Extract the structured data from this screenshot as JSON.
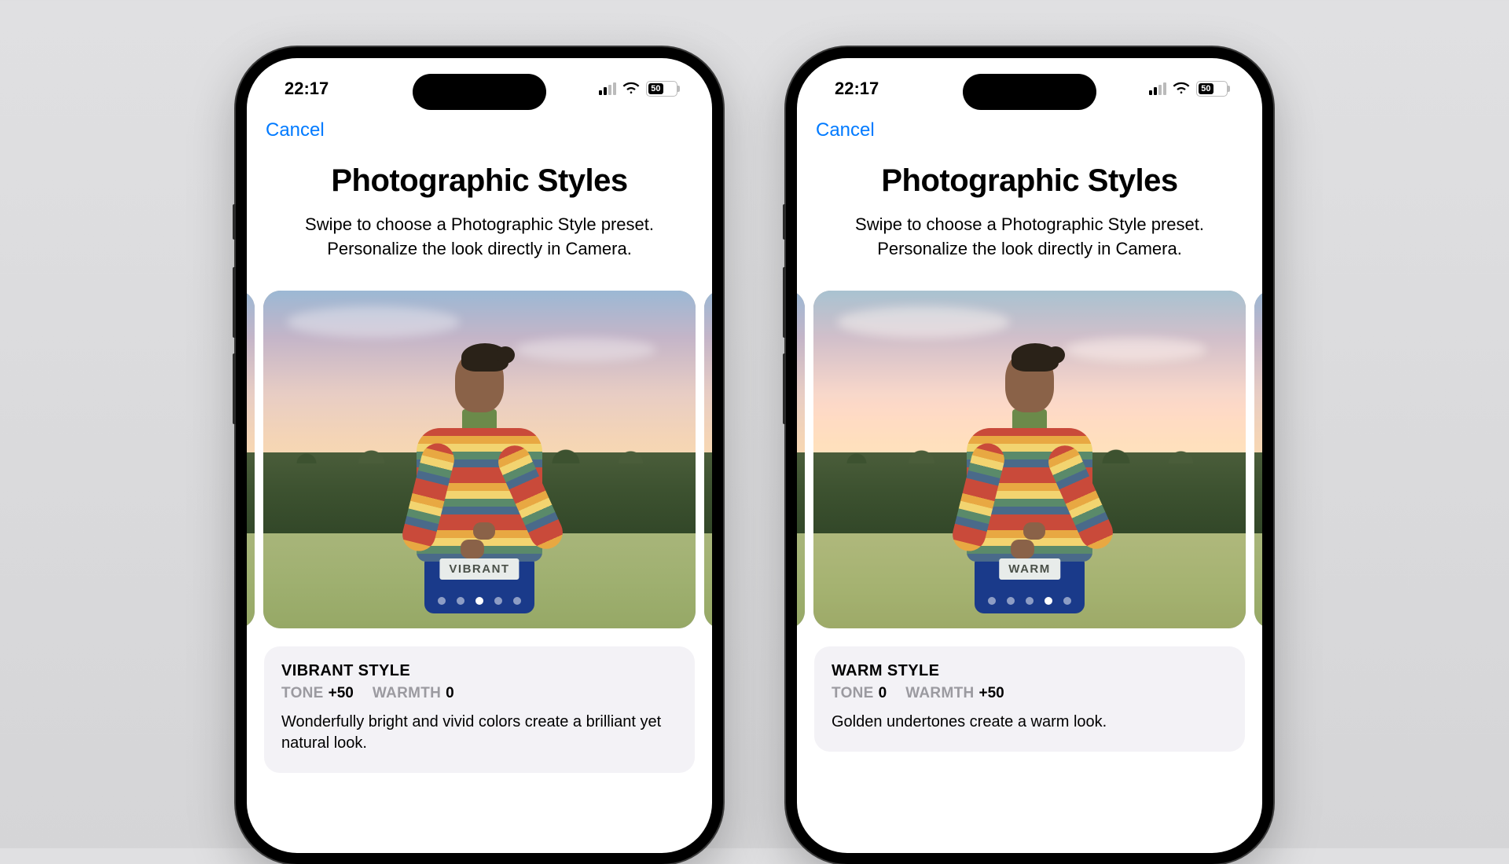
{
  "statusBar": {
    "time": "22:17",
    "batteryText": "50"
  },
  "nav": {
    "cancel": "Cancel"
  },
  "header": {
    "title": "Photographic Styles",
    "subtitle_line1": "Swipe to choose a Photographic Style preset.",
    "subtitle_line2": "Personalize the look directly in Camera."
  },
  "paramLabels": {
    "tone": "TONE",
    "warmth": "WARMTH"
  },
  "phones": [
    {
      "chipLabel": "VIBRANT",
      "activeDotIndex": 2,
      "styleName": "VIBRANT STYLE",
      "tone": "+50",
      "warmth": "0",
      "description": "Wonderfully bright and vivid colors create a brilliant yet natural look.",
      "tint": ""
    },
    {
      "chipLabel": "WARM",
      "activeDotIndex": 3,
      "styleName": "WARM STYLE",
      "tone": "0",
      "warmth": "+50",
      "description": "Golden undertones create a warm look.",
      "tint": "warm-tint"
    }
  ],
  "dotCount": 5
}
